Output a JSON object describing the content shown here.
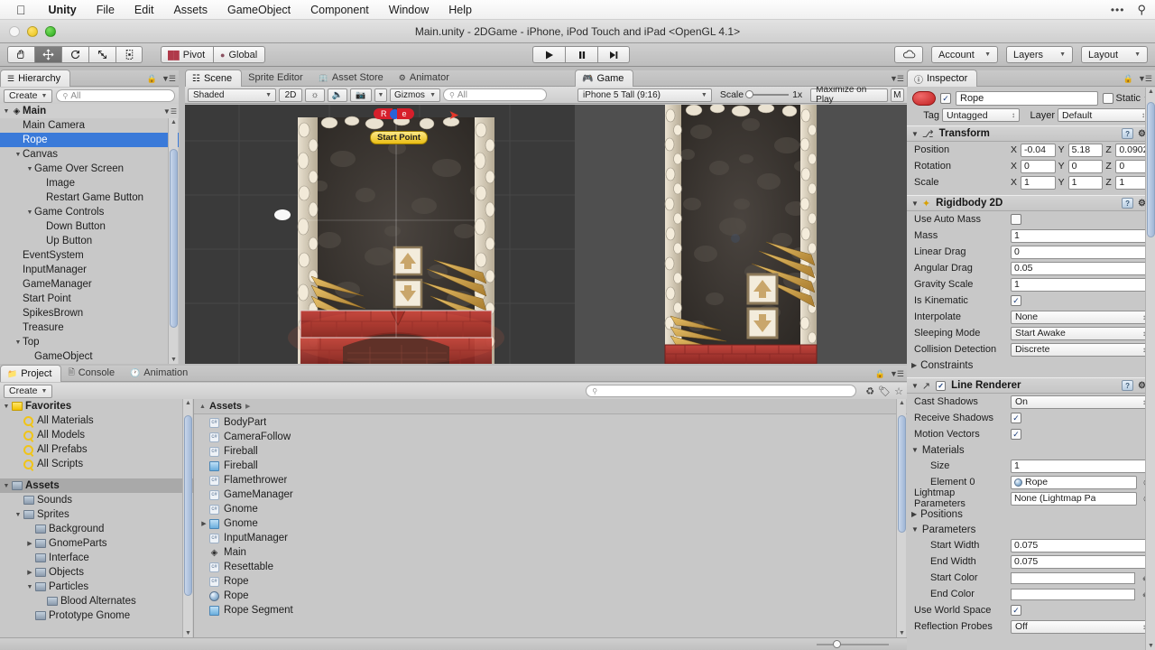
{
  "macmenu": {
    "apple": "apple-logo",
    "items": [
      "Unity",
      "File",
      "Edit",
      "Assets",
      "GameObject",
      "Component",
      "Window",
      "Help"
    ],
    "right_dots": "•••",
    "search_icon": "⌕"
  },
  "window": {
    "title": "Main.unity - 2DGame - iPhone, iPod Touch and iPad <OpenGL 4.1>"
  },
  "toolbar": {
    "transform_tools": [
      "hand-tool",
      "move-tool",
      "rotate-tool",
      "scale-tool",
      "rect-tool"
    ],
    "active_tool_index": 1,
    "pivot_label": "Pivot",
    "global_label": "Global",
    "play_label": "play",
    "pause_label": "pause",
    "step_label": "step",
    "cloud_label": "cloud",
    "account_label": "Account",
    "layers_label": "Layers",
    "layout_label": "Layout"
  },
  "hierarchy": {
    "tabs": [
      "Hierarchy"
    ],
    "create_label": "Create",
    "search_placeholder": "All",
    "root": {
      "label": "Main",
      "icon": "unity-scene-icon"
    },
    "items": [
      {
        "label": "Main Camera",
        "indent": 1,
        "icon": "none",
        "tri": "none",
        "selected": false
      },
      {
        "label": "Rope",
        "indent": 1,
        "icon": "none",
        "tri": "none",
        "selected": true
      },
      {
        "label": "Canvas",
        "indent": 1,
        "icon": "none",
        "tri": "down",
        "selected": false
      },
      {
        "label": "Game Over Screen",
        "indent": 2,
        "icon": "none",
        "tri": "down",
        "selected": false
      },
      {
        "label": "Image",
        "indent": 3,
        "icon": "none",
        "tri": "none",
        "selected": false
      },
      {
        "label": "Restart Game Button",
        "indent": 3,
        "icon": "none",
        "tri": "none",
        "selected": false
      },
      {
        "label": "Game Controls",
        "indent": 2,
        "icon": "none",
        "tri": "down",
        "selected": false
      },
      {
        "label": "Down Button",
        "indent": 3,
        "icon": "none",
        "tri": "none",
        "selected": false
      },
      {
        "label": "Up Button",
        "indent": 3,
        "icon": "none",
        "tri": "none",
        "selected": false
      },
      {
        "label": "EventSystem",
        "indent": 1,
        "icon": "none",
        "tri": "none",
        "selected": false
      },
      {
        "label": "InputManager",
        "indent": 1,
        "icon": "none",
        "tri": "none",
        "selected": false
      },
      {
        "label": "GameManager",
        "indent": 1,
        "icon": "none",
        "tri": "none",
        "selected": false
      },
      {
        "label": "Start Point",
        "indent": 1,
        "icon": "none",
        "tri": "none",
        "selected": false
      },
      {
        "label": "SpikesBrown",
        "indent": 1,
        "icon": "none",
        "tri": "none",
        "selected": false
      },
      {
        "label": "Treasure",
        "indent": 1,
        "icon": "none",
        "tri": "none",
        "selected": false
      },
      {
        "label": "Top",
        "indent": 1,
        "icon": "none",
        "tri": "down",
        "selected": false
      },
      {
        "label": "GameObject",
        "indent": 2,
        "icon": "none",
        "tri": "none",
        "selected": false
      }
    ]
  },
  "scene": {
    "tabs": [
      {
        "label": "Scene",
        "icon": "scene-grid-icon",
        "active": true
      },
      {
        "label": "Sprite Editor",
        "icon": "none",
        "active": false
      },
      {
        "label": "Asset Store",
        "icon": "store-icon",
        "active": false
      },
      {
        "label": "Animator",
        "icon": "animator-icon",
        "active": false
      }
    ],
    "shading_mode": "Shaded",
    "mode_2d": "2D",
    "lighting_icon": "sun-icon",
    "audio_icon": "speaker-icon",
    "effects_icon": "image-icon",
    "gizmos_label": "Gizmos",
    "search_placeholder": "All",
    "gizmo_labels": {
      "start_point": "Start Point",
      "rope": "Rope"
    }
  },
  "game": {
    "tabs": [
      {
        "label": "Game",
        "icon": "game-icon",
        "active": true
      }
    ],
    "resolution": "iPhone 5 Tall (9:16)",
    "scale_label": "Scale",
    "scale_value": "1x",
    "maximize_label": "Maximize on Play",
    "mute_label": "M"
  },
  "project": {
    "tabs": [
      {
        "label": "Project",
        "icon": "folder-icon",
        "active": true
      },
      {
        "label": "Console",
        "icon": "console-icon",
        "active": false
      },
      {
        "label": "Animation",
        "icon": "clock-icon",
        "active": false
      }
    ],
    "create_label": "Create",
    "search_placeholder": "",
    "breadcrumb": "Assets",
    "tree": [
      {
        "label": "Favorites",
        "indent": 0,
        "tri": "down",
        "icon": "folder-yellow",
        "bold": true
      },
      {
        "label": "All Materials",
        "indent": 1,
        "tri": "none",
        "icon": "favorite-search"
      },
      {
        "label": "All Models",
        "indent": 1,
        "tri": "none",
        "icon": "favorite-search"
      },
      {
        "label": "All Prefabs",
        "indent": 1,
        "tri": "none",
        "icon": "favorite-search"
      },
      {
        "label": "All Scripts",
        "indent": 1,
        "tri": "none",
        "icon": "favorite-search"
      },
      {
        "label": "",
        "indent": 0,
        "tri": "none",
        "icon": "none",
        "spacer": true
      },
      {
        "label": "Assets",
        "indent": 0,
        "tri": "down",
        "icon": "folder",
        "bold": true,
        "selected": true
      },
      {
        "label": "Sounds",
        "indent": 1,
        "tri": "none",
        "icon": "folder"
      },
      {
        "label": "Sprites",
        "indent": 1,
        "tri": "down",
        "icon": "folder"
      },
      {
        "label": "Background",
        "indent": 2,
        "tri": "none",
        "icon": "folder"
      },
      {
        "label": "GnomeParts",
        "indent": 2,
        "tri": "right",
        "icon": "folder"
      },
      {
        "label": "Interface",
        "indent": 2,
        "tri": "none",
        "icon": "folder"
      },
      {
        "label": "Objects",
        "indent": 2,
        "tri": "right",
        "icon": "folder"
      },
      {
        "label": "Particles",
        "indent": 2,
        "tri": "down",
        "icon": "folder"
      },
      {
        "label": "Blood Alternates",
        "indent": 3,
        "tri": "none",
        "icon": "folder"
      },
      {
        "label": "Prototype Gnome",
        "indent": 2,
        "tri": "none",
        "icon": "folder"
      }
    ],
    "assets": [
      {
        "label": "BodyPart",
        "icon": "script",
        "tri": "none"
      },
      {
        "label": "CameraFollow",
        "icon": "script",
        "tri": "none"
      },
      {
        "label": "Fireball",
        "icon": "script",
        "tri": "none"
      },
      {
        "label": "Fireball",
        "icon": "prefab",
        "tri": "none"
      },
      {
        "label": "Flamethrower",
        "icon": "script",
        "tri": "none"
      },
      {
        "label": "GameManager",
        "icon": "script",
        "tri": "none"
      },
      {
        "label": "Gnome",
        "icon": "script",
        "tri": "none"
      },
      {
        "label": "Gnome",
        "icon": "prefab",
        "tri": "right"
      },
      {
        "label": "InputManager",
        "icon": "script",
        "tri": "none"
      },
      {
        "label": "Main",
        "icon": "scene",
        "tri": "none"
      },
      {
        "label": "Resettable",
        "icon": "script",
        "tri": "none"
      },
      {
        "label": "Rope",
        "icon": "script",
        "tri": "none"
      },
      {
        "label": "Rope",
        "icon": "material",
        "tri": "none"
      },
      {
        "label": "Rope Segment",
        "icon": "prefab",
        "tri": "none"
      }
    ]
  },
  "inspector": {
    "tabs": [
      {
        "label": "Inspector",
        "icon": "inspector-icon",
        "active": true
      }
    ],
    "object_name": "Rope",
    "object_enabled": true,
    "static_label": "Static",
    "tag_label": "Tag",
    "tag_value": "Untagged",
    "layer_label": "Layer",
    "layer_value": "Default",
    "components": [
      {
        "title": "Transform",
        "icon": "transform-icon",
        "rows": [
          {
            "type": "vector3",
            "label": "Position",
            "x": "-0.04",
            "y": "5.18",
            "z": "0.0902"
          },
          {
            "type": "vector3",
            "label": "Rotation",
            "x": "0",
            "y": "0",
            "z": "0"
          },
          {
            "type": "vector3",
            "label": "Scale",
            "x": "1",
            "y": "1",
            "z": "1"
          }
        ]
      },
      {
        "title": "Rigidbody 2D",
        "icon": "rigidbody2d-icon",
        "rows": [
          {
            "type": "checkbox",
            "label": "Use Auto Mass",
            "checked": false
          },
          {
            "type": "text",
            "label": "Mass",
            "value": "1"
          },
          {
            "type": "text",
            "label": "Linear Drag",
            "value": "0"
          },
          {
            "type": "text",
            "label": "Angular Drag",
            "value": "0.05"
          },
          {
            "type": "text",
            "label": "Gravity Scale",
            "value": "1"
          },
          {
            "type": "checkbox",
            "label": "Is Kinematic",
            "checked": true
          },
          {
            "type": "enum",
            "label": "Interpolate",
            "value": "None"
          },
          {
            "type": "enum",
            "label": "Sleeping Mode",
            "value": "Start Awake"
          },
          {
            "type": "enum",
            "label": "Collision Detection",
            "value": "Discrete"
          },
          {
            "type": "foldout",
            "label": "Constraints",
            "open": false
          }
        ]
      },
      {
        "title": "Line Renderer",
        "icon": "line-renderer-icon",
        "has_enable_checkbox": true,
        "enabled": true,
        "rows": [
          {
            "type": "enum",
            "label": "Cast Shadows",
            "value": "On"
          },
          {
            "type": "checkbox",
            "label": "Receive Shadows",
            "checked": true
          },
          {
            "type": "checkbox",
            "label": "Motion Vectors",
            "checked": true
          },
          {
            "type": "foldout",
            "label": "Materials",
            "open": true
          },
          {
            "type": "text",
            "label": "Size",
            "value": "1",
            "indent": true
          },
          {
            "type": "object",
            "label": "Element 0",
            "value": "Rope",
            "icon": "material",
            "indent": true
          },
          {
            "type": "object",
            "label": "Lightmap Parameters",
            "value": "None (Lightmap Pa",
            "icon": "none"
          },
          {
            "type": "foldout",
            "label": "Positions",
            "open": false
          },
          {
            "type": "foldout",
            "label": "Parameters",
            "open": true
          },
          {
            "type": "text",
            "label": "Start Width",
            "value": "0.075",
            "indent": true
          },
          {
            "type": "text",
            "label": "End Width",
            "value": "0.075",
            "indent": true
          },
          {
            "type": "color",
            "label": "Start Color",
            "value": "#ffffff",
            "indent": true
          },
          {
            "type": "color",
            "label": "End Color",
            "value": "#ffffff",
            "indent": true
          },
          {
            "type": "checkbox",
            "label": "Use World Space",
            "checked": true
          },
          {
            "type": "enum",
            "label": "Reflection Probes",
            "value": "Off"
          }
        ]
      }
    ]
  },
  "colors": {
    "selection_blue": "#3a7ad9",
    "panel_gray": "#c8c8c8",
    "toolbar_gray": "#bdbdbd",
    "gizmo_yellow": "#f2c21a"
  }
}
